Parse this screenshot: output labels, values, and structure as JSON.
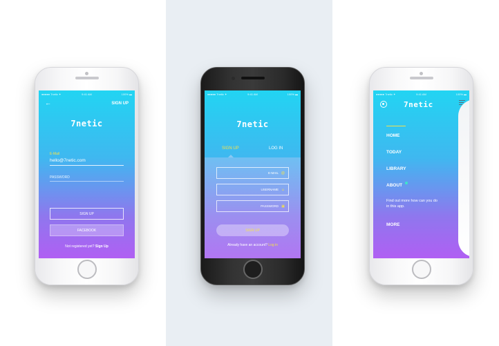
{
  "status_bar": {
    "carrier": "●●●●● 7netic ✦",
    "time": "9:41 AM",
    "battery": "100% ▬"
  },
  "brand": {
    "logo": "7netic"
  },
  "colors": {
    "gradient_top": "#22d4f2",
    "gradient_bottom": "#b05ff3",
    "accent_yellow": "#f4e24a",
    "accent_teal": "#3ee6c8"
  },
  "screen_signup": {
    "back_icon": "←",
    "title": "SIGN UP",
    "email_label": "E-Mail",
    "email_value": "hello@7netic.com",
    "password_label": "PASSWORD",
    "signup_button": "SIGN UP",
    "facebook_button": "FACEBOOK",
    "footer_text": "Not registered yet?",
    "footer_link": "Sign Up"
  },
  "screen_login": {
    "tabs": [
      {
        "label": "SIGN UP",
        "active": true
      },
      {
        "label": "LOG IN",
        "active": false
      }
    ],
    "fields": [
      {
        "label": "E-MAIL",
        "icon": "@"
      },
      {
        "label": "USERNAME",
        "icon": "☺"
      },
      {
        "label": "PASSWORD",
        "icon": "🔒"
      }
    ],
    "submit_button": "SIGN UP",
    "footer_text": "Already have an account?",
    "footer_link": "Log in"
  },
  "screen_menu": {
    "items": [
      "HOME",
      "TODAY",
      "LIBRARY",
      "ABOUT"
    ],
    "description": "Find out more how can you do in this app.",
    "more": "MORE"
  }
}
